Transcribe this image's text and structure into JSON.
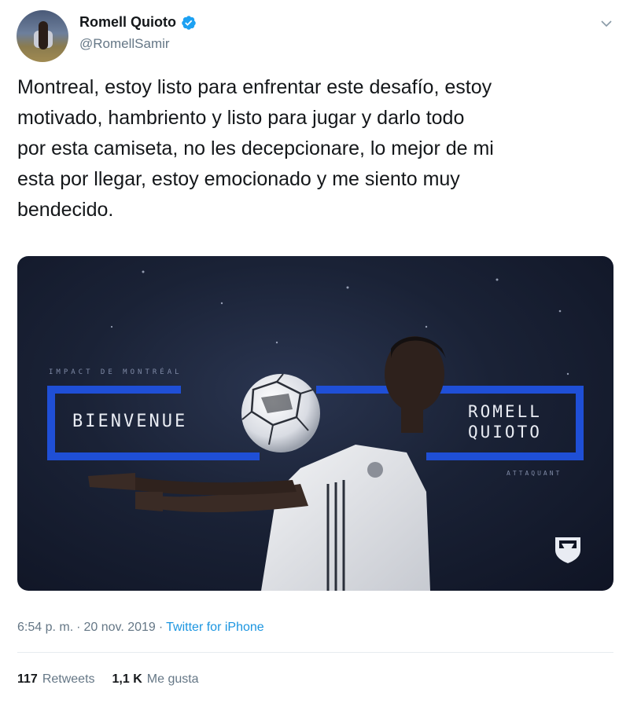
{
  "author": {
    "name": "Romell Quioto",
    "handle": "@RomellSamir"
  },
  "tweet": {
    "text": "Montreal, estoy listo para enfrentar este desafío, estoy\nmotivado, hambriento y listo para jugar y darlo todo\npor esta camiseta, no les decepcionare, lo mejor de mi\nesta por llegar, estoy emocionado y me siento muy\nbendecido."
  },
  "media": {
    "caption_top": "IMPACT DE MONTRÉAL",
    "welcome": "BIENVENUE",
    "player_name": "ROMELL\nQUIOTO",
    "position": "ATTAQUANT"
  },
  "meta": {
    "time": "6:54 p. m.",
    "separator": "·",
    "date": "20 nov. 2019",
    "source": "Twitter for iPhone"
  },
  "stats": {
    "retweets_count": "117",
    "retweets_label": "Retweets",
    "likes_count": "1,1 K",
    "likes_label": "Me gusta"
  },
  "icons": [
    "verified-badge-icon",
    "chevron-down-icon",
    "club-crest-icon"
  ],
  "colors": {
    "verified": "#1da1f2",
    "link": "#1b95e0",
    "muted": "#657786",
    "accent_blue": "#1f4fd6"
  }
}
